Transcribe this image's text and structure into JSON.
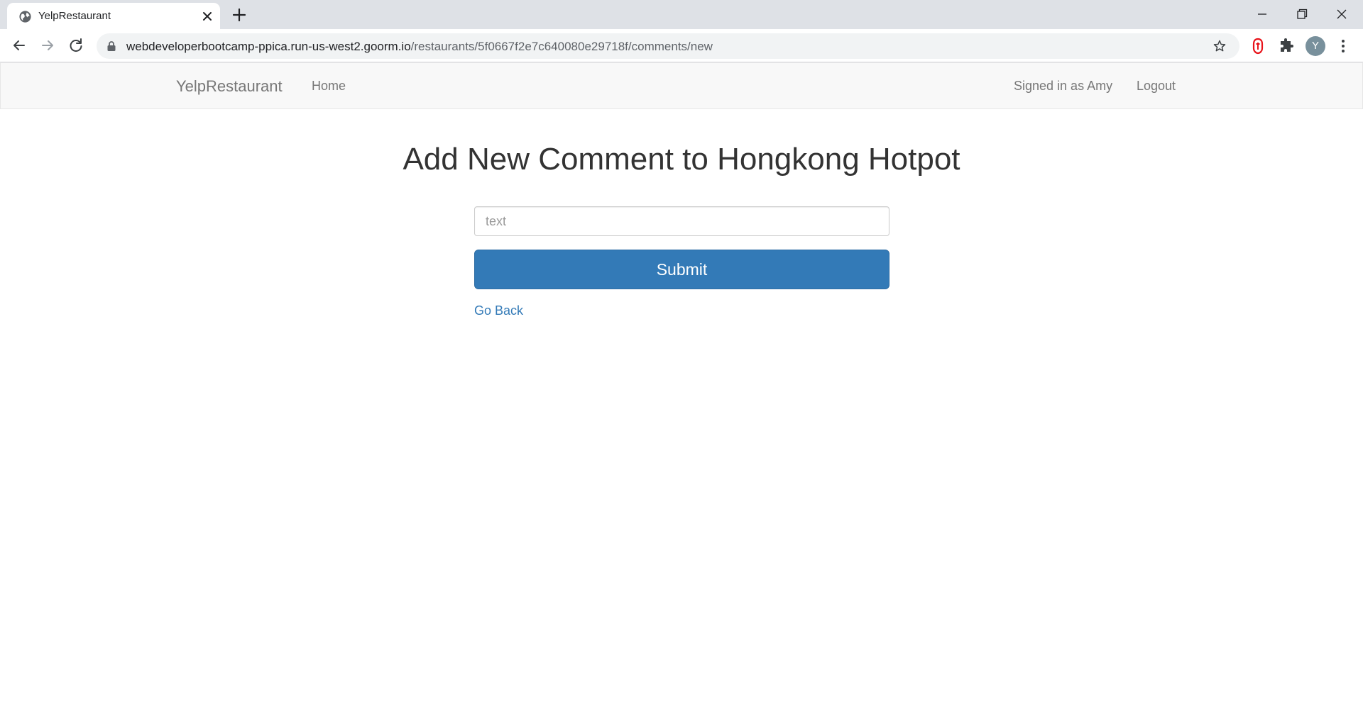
{
  "browser": {
    "tab_title": "YelpRestaurant",
    "url_host": "webdeveloperbootcamp-ppica.run-us-west2.goorm.io",
    "url_path": "/restaurants/5f0667f2e7c640080e29718f/comments/new",
    "profile_initial": "Y",
    "icons": {
      "favicon": "globe-icon",
      "close": "close-icon",
      "new_tab": "plus-icon",
      "back": "arrow-left-icon",
      "forward": "arrow-right-icon",
      "reload": "reload-icon",
      "lock": "lock-icon",
      "bookmark": "star-icon",
      "extension_1": "red-shield-extension-icon",
      "extensions": "puzzle-icon",
      "menu": "kebab-menu-icon"
    }
  },
  "navbar": {
    "brand": "YelpRestaurant",
    "home": "Home",
    "signed_in": "Signed in as Amy",
    "logout": "Logout"
  },
  "main": {
    "title": "Add New Comment to Hongkong Hotpot",
    "text_placeholder": "text",
    "text_value": "",
    "submit_label": "Submit",
    "go_back": "Go Back"
  },
  "colors": {
    "primary": "#337ab7",
    "navbar_bg": "#f8f8f8",
    "chrome_bg": "#dee1e6"
  }
}
